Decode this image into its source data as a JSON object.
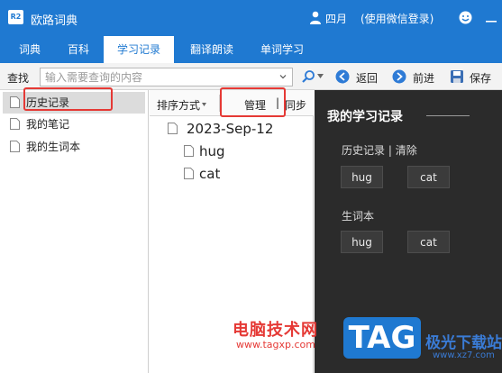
{
  "app": {
    "title": "欧路词典",
    "icon_text": "R2"
  },
  "titlebar": {
    "user_name": "四月",
    "login_hint": "(使用微信登录)"
  },
  "tabs": [
    {
      "label": "词典",
      "active": false
    },
    {
      "label": "百科",
      "active": false
    },
    {
      "label": "学习记录",
      "active": true
    },
    {
      "label": "翻译朗读",
      "active": false
    },
    {
      "label": "单词学习",
      "active": false
    }
  ],
  "toolbar": {
    "search_label": "查找",
    "search_placeholder": "输入需要查询的内容",
    "search_value": "",
    "back_label": "返回",
    "forward_label": "前进",
    "save_label": "保存"
  },
  "sidebar": {
    "items": [
      {
        "label": "历史记录",
        "selected": true
      },
      {
        "label": "我的笔记",
        "selected": false
      },
      {
        "label": "我的生词本",
        "selected": false
      }
    ]
  },
  "middle": {
    "sort_label": "排序方式",
    "manage_label": "管理",
    "divider": "|",
    "sync_label": "同步",
    "tree": [
      {
        "label": "2023-Sep-12",
        "level": 0
      },
      {
        "label": "hug",
        "level": 1
      },
      {
        "label": "cat",
        "level": 1
      }
    ]
  },
  "panel": {
    "title": "我的学习记录",
    "history_label": "历史记录",
    "separator": "|",
    "clear_label": "清除",
    "history_words": [
      "hug",
      "cat"
    ],
    "vocab_label": "生词本",
    "vocab_words": [
      "hug",
      "cat"
    ]
  },
  "watermark": {
    "cn_text": "电脑技术网",
    "url": "www.tagxp.com",
    "tag": "TAG",
    "dl_text": "极光下载站",
    "dl_url": "www.xz7.com"
  },
  "colors": {
    "brand": "#1f79d1",
    "panel_bg": "#2b2b2b",
    "highlight": "#e53935"
  },
  "icons": [
    "app-icon",
    "user-icon",
    "smile-icon",
    "minimize-icon",
    "magnify-icon",
    "back-icon",
    "forward-icon",
    "save-icon",
    "document-icon"
  ]
}
